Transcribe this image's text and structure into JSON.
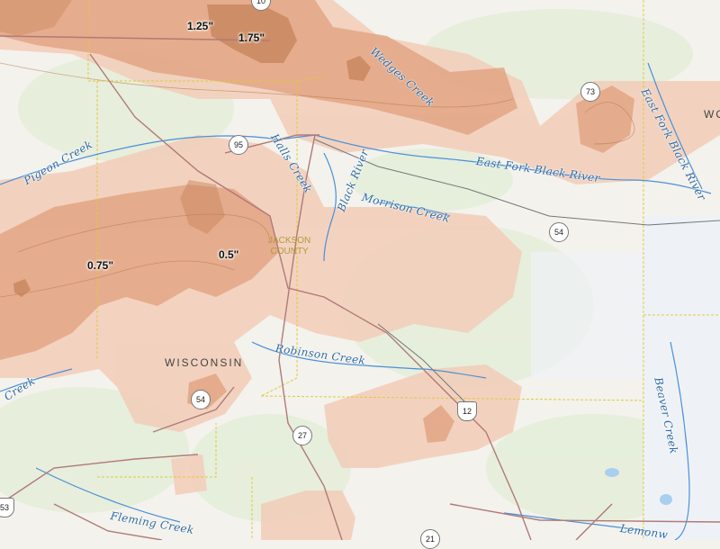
{
  "map": {
    "contour_labels": [
      "1.25\"",
      "1.75\"",
      "0.75\"",
      "0.5\""
    ],
    "county_label": [
      "JACKSON",
      "COUNTY"
    ],
    "state_label": "WISCONSIN",
    "water_labels": {
      "halls_creek": "Halls Creek",
      "black_river": "Black River",
      "morrison_creek": "Morrison Creek",
      "east_fork_black_river": "East Fork Black River",
      "east_fork_black_river_2": "East Fork Black River",
      "wedges_creek": "Wedges Creek",
      "pigeon_creek": "Pigeon Creek",
      "robinson_creek": "Robinson Creek",
      "beaver_creek": "Beaver Creek",
      "fleming_creek": "Fleming Creek",
      "lemonweir": "Lemonw",
      "creek_left": "Creek"
    },
    "route_shields": [
      "95",
      "73",
      "54",
      "27",
      "12",
      "54",
      "21",
      "10",
      "53"
    ],
    "edge_label": "WO",
    "colors": {
      "light_precip": "#f2cdb8",
      "mid_precip": "#e2a684",
      "heavy_precip": "#c9875f",
      "water": "#2f6aa3",
      "county_line": "#e0c93c",
      "road": "#b07a7a"
    }
  }
}
